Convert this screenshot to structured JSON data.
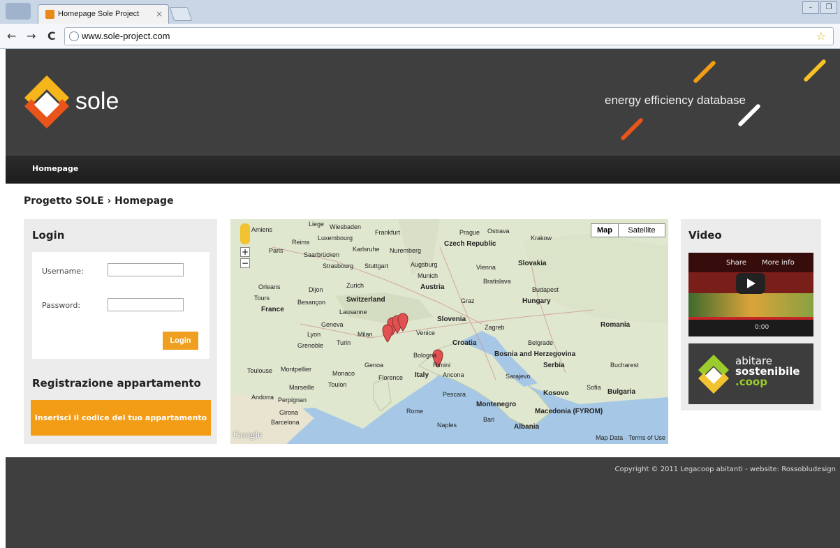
{
  "browser": {
    "tab_title": "Homepage Sole Project",
    "tab_close": "×",
    "url": "www.sole-project.com",
    "back": "←",
    "forward": "→",
    "reload": "C",
    "star": "☆",
    "win_min": "–",
    "win_max": "❐"
  },
  "header": {
    "logo_text": "sole",
    "tagline": "energy efficiency database"
  },
  "nav": {
    "homepage": "Homepage"
  },
  "breadcrumb": "Progetto SOLE › Homepage",
  "login": {
    "title": "Login",
    "username_label": "Username:",
    "password_label": "Password:",
    "username_value": "",
    "password_value": "",
    "button": "Login"
  },
  "registration": {
    "title": "Registrazione appartamento",
    "button": "Inserisci il codice del tuo appartamento"
  },
  "map": {
    "type_map": "Map",
    "type_satellite": "Satellite",
    "zoom_in": "+",
    "zoom_out": "−",
    "google": "Google",
    "footer": "Map Data · Terms of Use",
    "labels": [
      "Prague",
      "Ostrava",
      "Krakow",
      "Czech Republic",
      "Frankfurt",
      "Luxembourg",
      "Paris",
      "Reims",
      "Saarbrücken",
      "Strasbourg",
      "Karlsruhe",
      "Nuremberg",
      "Stuttgart",
      "Augsburg",
      "Munich",
      "Zurich",
      "Switzerland",
      "Vienna",
      "Bratislava",
      "Slovakia",
      "Budapest",
      "Hungary",
      "Austria",
      "Graz",
      "Slovenia",
      "Zagreb",
      "Croatia",
      "Lausanne",
      "Geneva",
      "Lyon",
      "Grenoble",
      "Turin",
      "Milan",
      "Venice",
      "Bologna",
      "Genoa",
      "Florence",
      "Italy",
      "Ancona",
      "Monaco",
      "Marseille",
      "Toulon",
      "Toulouse",
      "Montpellier",
      "Perpignan",
      "Andorra",
      "Barcelona",
      "Girona",
      "Rome",
      "Naples",
      "Bari",
      "Pescara",
      "Sarajevo",
      "Bosnia and Herzegovina",
      "Serbia",
      "Belgrade",
      "Romania",
      "Bucharest",
      "Bulgaria",
      "Sofia",
      "Kosovo",
      "Montenegro",
      "Albania",
      "Macedonia (FYROM)",
      "France",
      "Rimini",
      "Dijon",
      "Orleans",
      "Tours",
      "Besançon",
      "Liege",
      "Wiesbaden",
      "Amiens"
    ]
  },
  "video": {
    "title": "Video",
    "share": "Share",
    "more_info": "More info",
    "time": "0:00"
  },
  "banner": {
    "line1": "abitare",
    "line2": "sostenibile",
    "line3": ".coop"
  },
  "footer": {
    "copyright": "Copyright © 2011 Legacoop abitanti - website: Rossobludesign"
  },
  "colors": {
    "header_bg": "#3f3f3f",
    "accent_orange": "#f39c16",
    "banner_green": "#9ccc2b"
  }
}
